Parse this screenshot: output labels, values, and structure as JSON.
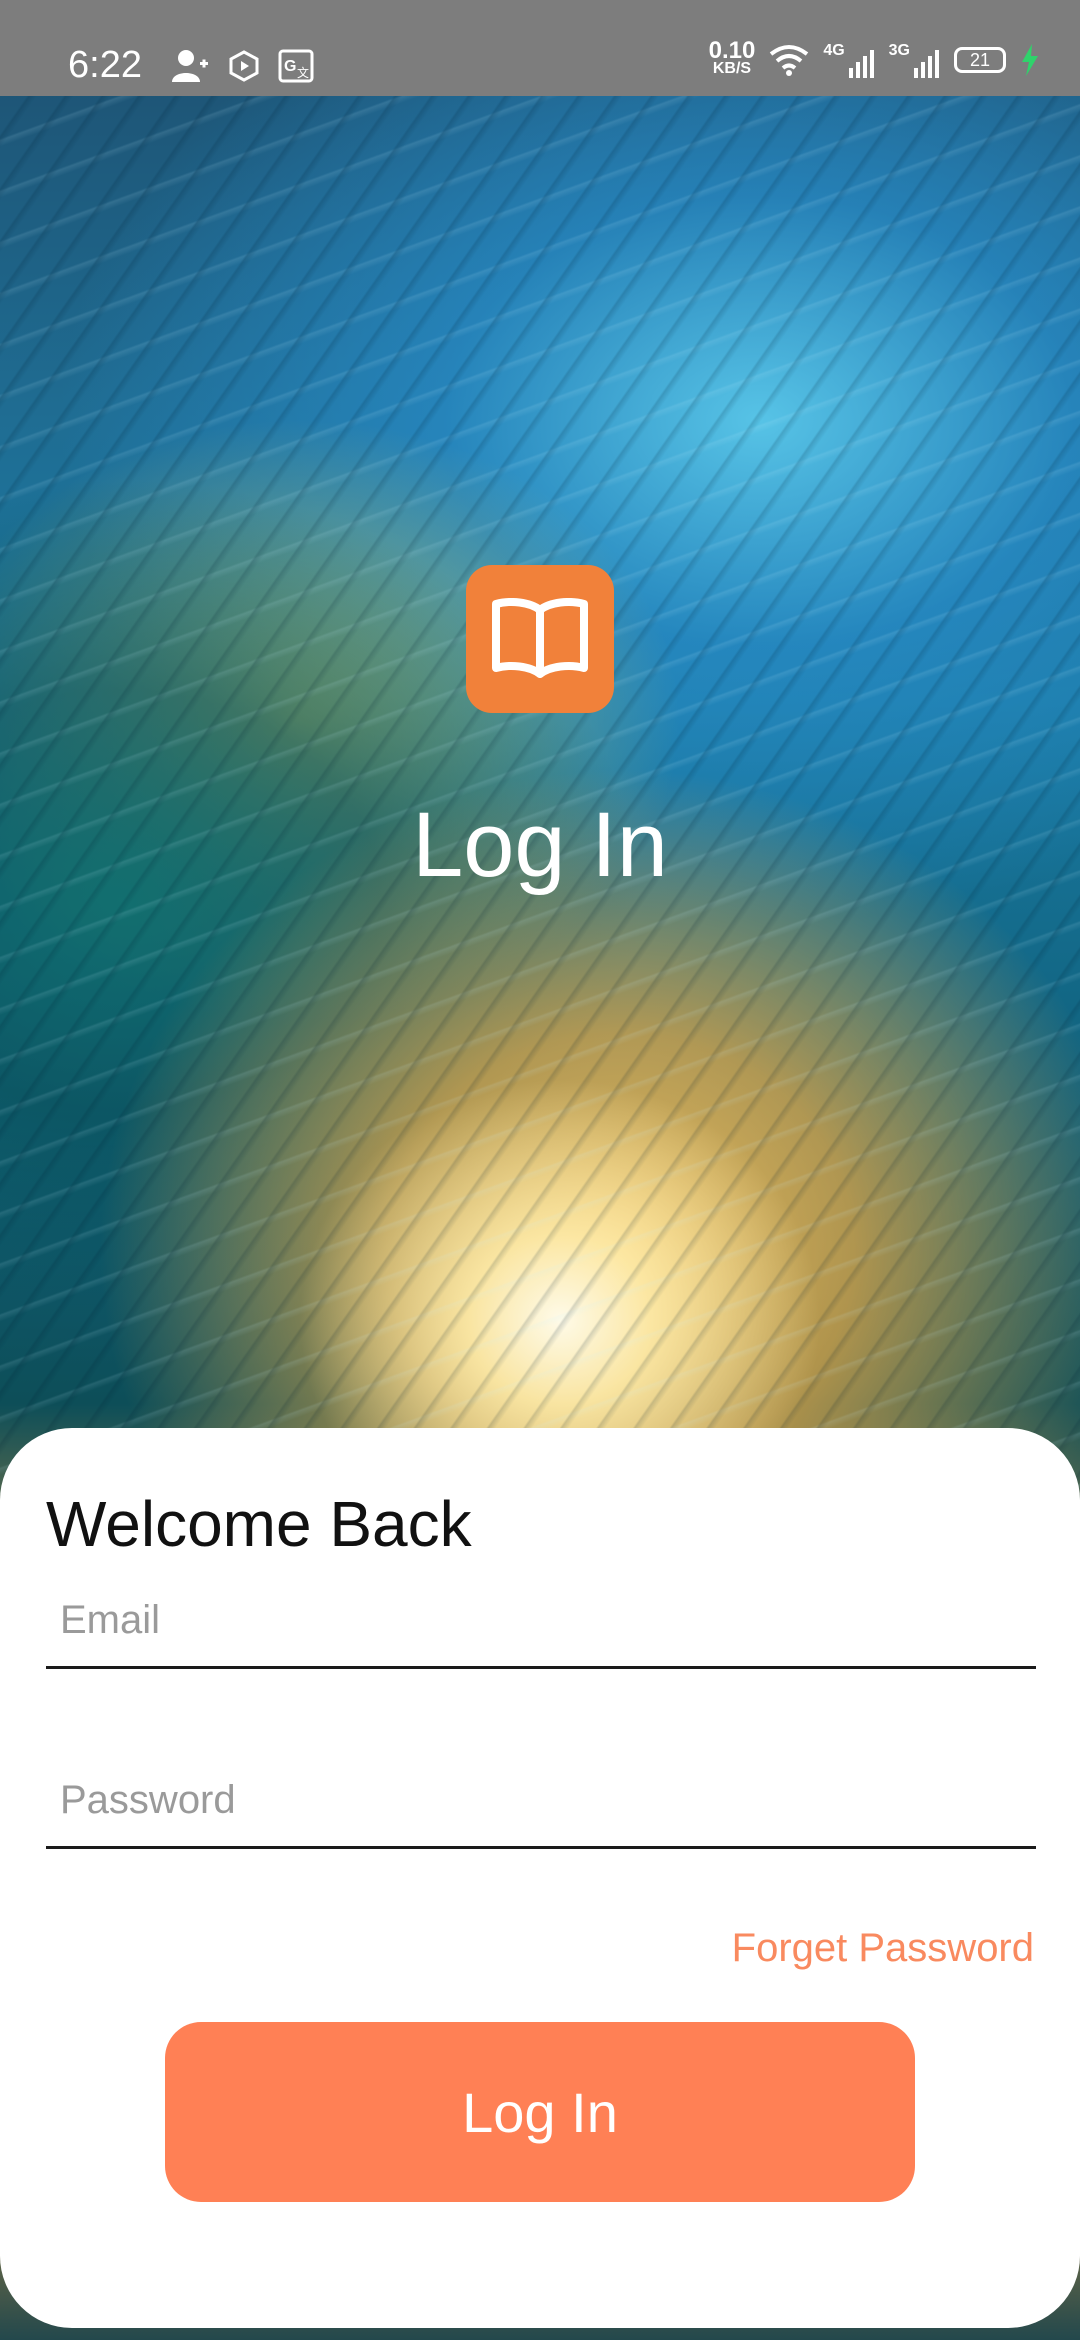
{
  "status_bar": {
    "time": "6:22",
    "net_speed_value": "0.10",
    "net_speed_unit": "KB/S",
    "signal1_label": "4G",
    "signal2_label": "3G",
    "battery_level": "21",
    "icons": [
      "person-add-icon",
      "hexagon-play-icon",
      "translate-icon",
      "wifi-icon",
      "signal-icon",
      "battery-icon",
      "charging-bolt-icon"
    ]
  },
  "hero": {
    "logo_icon": "open-book-icon",
    "logo_color": "#f1813a",
    "title": "Log In"
  },
  "form": {
    "heading": "Welcome Back",
    "email_placeholder": "Email",
    "email_value": "",
    "password_placeholder": "Password",
    "password_value": "",
    "forgot_label": "Forget Password",
    "submit_label": "Log In",
    "accent_color": "#ff8055"
  }
}
